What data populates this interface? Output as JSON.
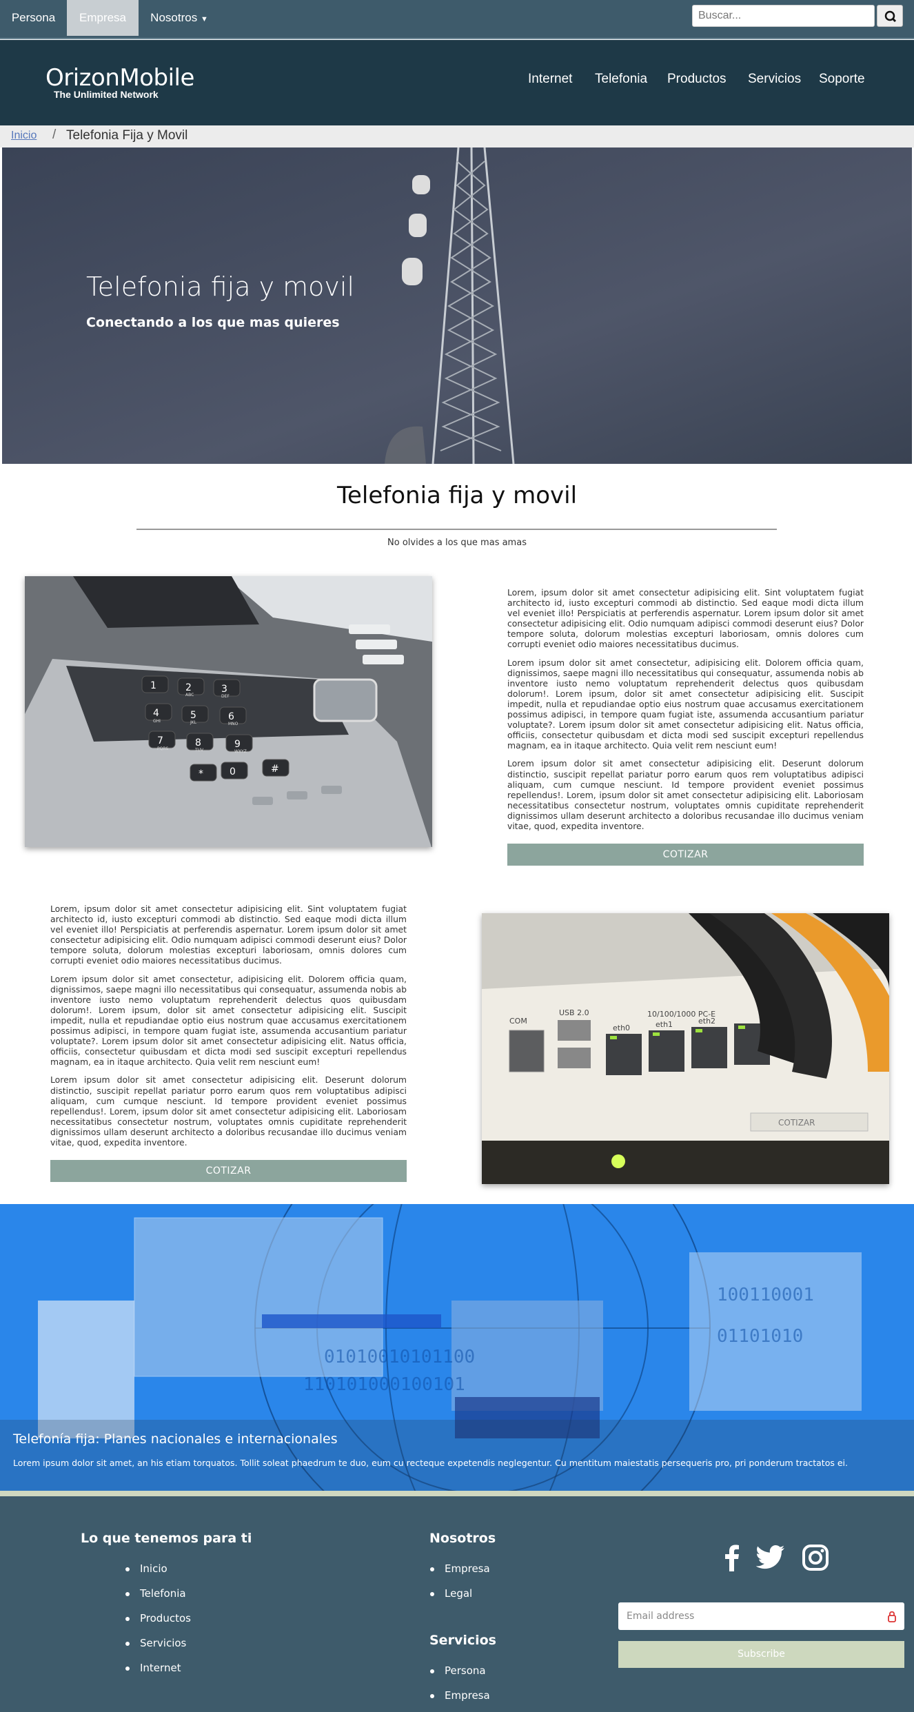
{
  "topbar": {
    "links": [
      "Persona",
      "Empresa",
      "Nosotros"
    ],
    "active": "Empresa",
    "search_placeholder": "Buscar..."
  },
  "header": {
    "logo": "OrizonMobile",
    "tagline": "The Unlimited Network",
    "nav": [
      "Internet",
      "Telefonia",
      "Productos",
      "Servicios",
      "Soporte"
    ]
  },
  "breadcrumb": {
    "home": "Inicio",
    "separator": "/",
    "current": "Telefonia Fija y Movil"
  },
  "hero": {
    "title": "Telefonia fija y movil",
    "subtitle": "Conectando a los que mas quieres"
  },
  "section": {
    "title": "Telefonia fija y movil",
    "subtitle": "No olvides a los que mas amas"
  },
  "blocks": [
    {
      "paragraphs": [
        "Lorem, ipsum dolor sit amet consectetur adipisicing elit. Sint voluptatem fugiat architecto id, iusto excepturi commodi ab distinctio. Sed eaque modi dicta illum vel eveniet illo! Perspiciatis at perferendis aspernatur. Lorem ipsum dolor sit amet consectetur adipisicing elit. Odio numquam adipisci commodi deserunt eius? Dolor tempore soluta, dolorum molestias excepturi laboriosam, omnis dolores cum corrupti eveniet odio maiores necessitatibus ducimus.",
        "Lorem ipsum dolor sit amet consectetur, adipisicing elit. Dolorem officia quam, dignissimos, saepe magni illo necessitatibus qui consequatur, assumenda nobis ab inventore iusto nemo voluptatum reprehenderit delectus quos quibusdam dolorum!. Lorem ipsum, dolor sit amet consectetur adipisicing elit. Suscipit impedit, nulla et repudiandae optio eius nostrum quae accusamus exercitationem possimus adipisci, in tempore quam fugiat iste, assumenda accusantium pariatur voluptate?. Lorem ipsum dolor sit amet consectetur adipisicing elit. Natus officia, officiis, consectetur quibusdam et dicta modi sed suscipit excepturi repellendus magnam, ea in itaque architecto. Quia velit rem nesciunt eum!",
        "Lorem ipsum dolor sit amet consectetur adipisicing elit. Deserunt dolorum distinctio, suscipit repellat pariatur porro earum quos rem voluptatibus adipisci aliquam, cum cumque nesciunt. Id tempore provident eveniet possimus repellendus!. Lorem, ipsum dolor sit amet consectetur adipisicing elit. Laboriosam necessitatibus consectetur nostrum, voluptates omnis cupiditate reprehenderit dignissimos ullam deserunt architecto a doloribus recusandae illo ducimus veniam vitae, quod, expedita inventore."
      ],
      "button": "COTIZAR"
    },
    {
      "paragraphs": [
        "Lorem, ipsum dolor sit amet consectetur adipisicing elit. Sint voluptatem fugiat architecto id, iusto excepturi commodi ab distinctio. Sed eaque modi dicta illum vel eveniet illo! Perspiciatis at perferendis aspernatur. Lorem ipsum dolor sit amet consectetur adipisicing elit. Odio numquam adipisci commodi deserunt eius? Dolor tempore soluta, dolorum molestias excepturi laboriosam, omnis dolores cum corrupti eveniet odio maiores necessitatibus ducimus.",
        "Lorem ipsum dolor sit amet consectetur, adipisicing elit. Dolorem officia quam, dignissimos, saepe magni illo necessitatibus qui consequatur, assumenda nobis ab inventore iusto nemo voluptatum reprehenderit delectus quos quibusdam dolorum!. Lorem ipsum, dolor sit amet consectetur adipisicing elit. Suscipit impedit, nulla et repudiandae optio eius nostrum quae accusamus exercitationem possimus adipisci, in tempore quam fugiat iste, assumenda accusantium pariatur voluptate?. Lorem ipsum dolor sit amet consectetur adipisicing elit. Natus officia, officiis, consectetur quibusdam et dicta modi sed suscipit excepturi repellendus magnam, ea in itaque architecto. Quia velit rem nesciunt eum!",
        "Lorem ipsum dolor sit amet consectetur adipisicing elit. Deserunt dolorum distinctio, suscipit repellat pariatur porro earum quos rem voluptatibus adipisci aliquam, cum cumque nesciunt. Id tempore provident eveniet possimus repellendus!. Lorem, ipsum dolor sit amet consectetur adipisicing elit. Laboriosam necessitatibus consectetur nostrum, voluptates omnis cupiditate reprehenderit dignissimos ullam deserunt architecto a doloribus recusandae illo ducimus veniam vitae, quod, expedita inventore."
      ],
      "button": "COTIZAR"
    }
  ],
  "phone_keypad": {
    "keys": [
      "1",
      "2",
      "3",
      "4",
      "5",
      "6",
      "7",
      "8",
      "9",
      "*",
      "0",
      "#"
    ],
    "letters": [
      "ABC",
      "DEF",
      "GHI",
      "JKL",
      "MNO",
      "PQRS",
      "TUV",
      "WXYZ"
    ]
  },
  "router_labels": {
    "ports": "10/100/1000 PC-E",
    "eth0": "eth0",
    "eth1": "eth1",
    "eth2": "eth2",
    "com": "COM",
    "usb": "USB 2.0",
    "sticker": "COTIZAR"
  },
  "banner": {
    "title": "Telefonía fija: Planes nacionales e internacionales",
    "text": "Lorem ipsum dolor sit amet, an his etiam torquatos. Tollit soleat phaedrum te duo, eum cu recteque expetendis neglegentur. Cu mentitum maiestatis persequeris pro, pri ponderum tractatos ei."
  },
  "footer": {
    "col1": {
      "heading": "Lo que tenemos para ti",
      "items": [
        "Inicio",
        "Telefonia",
        "Productos",
        "Servicios",
        "Internet"
      ]
    },
    "col2": {
      "heading": "Nosotros",
      "items": [
        "Empresa",
        "Legal"
      ]
    },
    "col3": {
      "heading": "Servicios",
      "items": [
        "Persona",
        "Empresa"
      ]
    },
    "social_icons": [
      "facebook-icon",
      "twitter-icon",
      "instagram-icon"
    ],
    "email_placeholder": "Email address",
    "subscribe": "Subscribe"
  },
  "colors": {
    "topbar": "#3e5b6b",
    "header": "#1e3947",
    "button": "#8ca59d",
    "subscribe": "#cdd8be",
    "link": "#5577bb"
  }
}
